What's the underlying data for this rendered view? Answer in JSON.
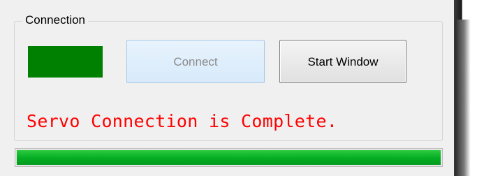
{
  "connection_group": {
    "label": "Connection"
  },
  "status_indicator": {
    "color": "#008000"
  },
  "buttons": {
    "connect_label": "Connect",
    "connect_enabled": false,
    "start_window_label": "Start Window"
  },
  "status_message": {
    "text": "Servo Connection is Complete.",
    "color": "#ff0000"
  },
  "progress_bar": {
    "value_percent": 100,
    "color": "#06b025"
  }
}
